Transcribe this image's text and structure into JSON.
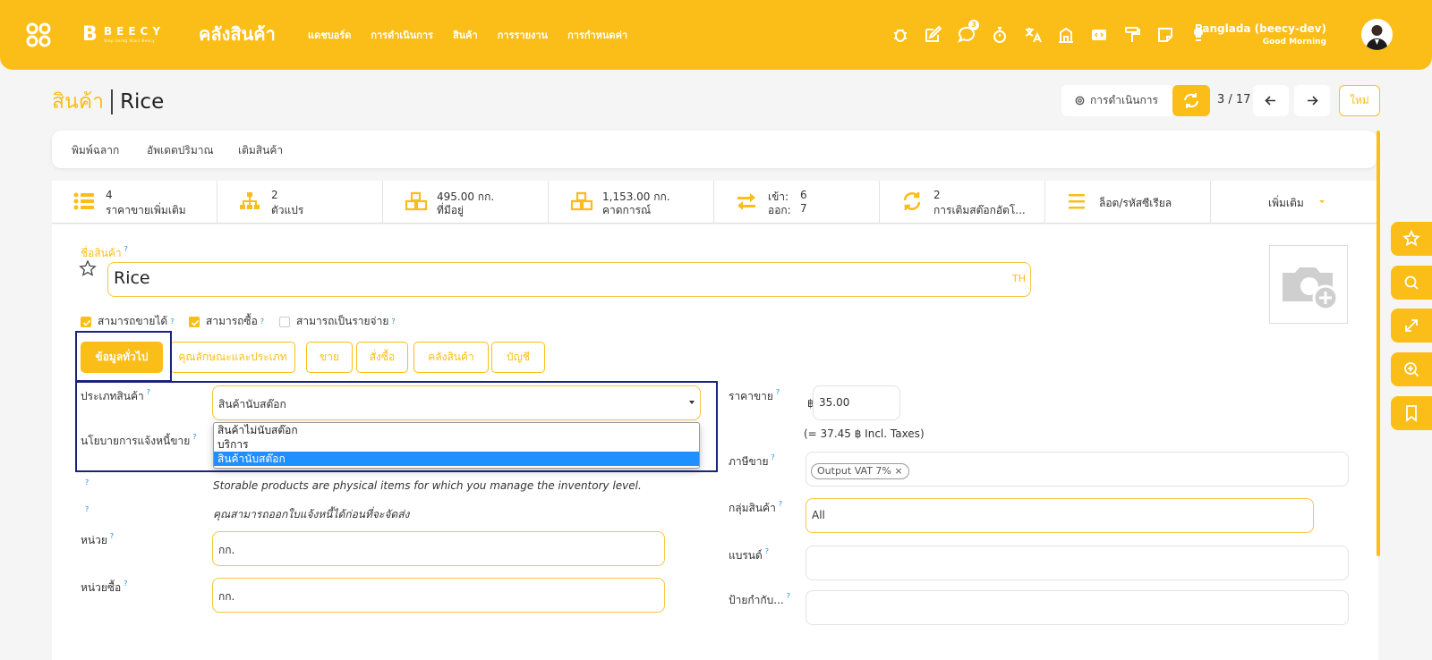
{
  "brand": {
    "logo_letter": "B",
    "logo_name": "BEECY",
    "logo_tagline": "Step Using Start Beecy",
    "app_title": "คลังสินค้า"
  },
  "menu": [
    "แดชบอร์ด",
    "การดำเนินการ",
    "สินค้า",
    "การรายงาน",
    "การกำหนดค่า"
  ],
  "system": {
    "chat_badge": "3"
  },
  "user": {
    "name": "Panglada (beecy-dev)",
    "greeting": "Good Morning"
  },
  "breadcrumb": {
    "parent": "สินค้า",
    "current": "Rice"
  },
  "control": {
    "actions_label": "การดำเนินการ",
    "pager": "3 / 17",
    "new_label": "ใหม่"
  },
  "header_buttons": [
    "พิมพ์ฉลาก",
    "อัพเดตปริมาณ",
    "เติมสินค้า"
  ],
  "stats": [
    {
      "icon": "list-icon",
      "value": "4",
      "label": "ราคาขายเพิ่มเติม"
    },
    {
      "icon": "sitemap-icon",
      "value": "2",
      "label": "ตัวแปร"
    },
    {
      "icon": "cubes-icon",
      "value": "495.00 กก.",
      "label": "ที่มีอยู่"
    },
    {
      "icon": "cubes-icon",
      "value": "1,153.00 กก.",
      "label": "คาดการณ์"
    },
    {
      "icon": "exchange-icon",
      "in_label": "เข้า:",
      "in_value": "6",
      "out_label": "ออก:",
      "out_value": "7"
    },
    {
      "icon": "refresh-icon",
      "value": "2",
      "label": "การเติมสต๊อกอัตโ..."
    },
    {
      "icon": "bars-icon",
      "label": "ล็อต/รหัสซีเรียล"
    },
    {
      "label": "เพิ่มเติม"
    }
  ],
  "form": {
    "name_label": "ชื่อสินค้า",
    "name_value": "Rice",
    "lang": "TH",
    "help": "?",
    "checkboxes": [
      {
        "label": "สามารถขายได้",
        "checked": true
      },
      {
        "label": "สามารถซื้อ",
        "checked": true
      },
      {
        "label": "สามารถเป็นรายจ่าย",
        "checked": false
      }
    ],
    "tabs": [
      "ข้อมูลทั่วไป",
      "คุณลักษณะและประเภท",
      "ขาย",
      "สั่งซื้อ",
      "คลังสินค้า",
      "บัญชี"
    ],
    "product_type_label": "ประเภทสินค้า",
    "product_type_value": "สินค้านับสต๊อก",
    "product_type_options": [
      "สินค้าไม่นับสต๊อก",
      "บริการ",
      "สินค้านับสต๊อก"
    ],
    "invoice_policy_label": "นโยบายการแจ้งหนี้ขาย",
    "help_storable": "Storable products are physical items for which you manage the inventory level.",
    "help_invoice": "คุณสามารถออกใบแจ้งหนี้ได้ก่อนที่จะจัดส่ง",
    "uom_label": "หน่วย",
    "uom_value": "กก.",
    "purchase_uom_label": "หน่วยซื้อ",
    "purchase_uom_value": "กก.",
    "sale_price_label": "ราคาขาย",
    "currency": "฿",
    "sale_price_value": "35.00",
    "incl_taxes": "(= 37.45 ฿ Incl. Taxes)",
    "tax_label": "ภาษีขาย",
    "tax_tag": "Output VAT 7%",
    "category_label": "กลุ่มสินค้า",
    "category_value": "All",
    "brand_label": "แบรนด์",
    "tags_label": "ป้ายกำกับ..."
  },
  "colors": {
    "accent": "#fbbd17",
    "focus": "#1a237e",
    "selection": "#1e90ff"
  }
}
